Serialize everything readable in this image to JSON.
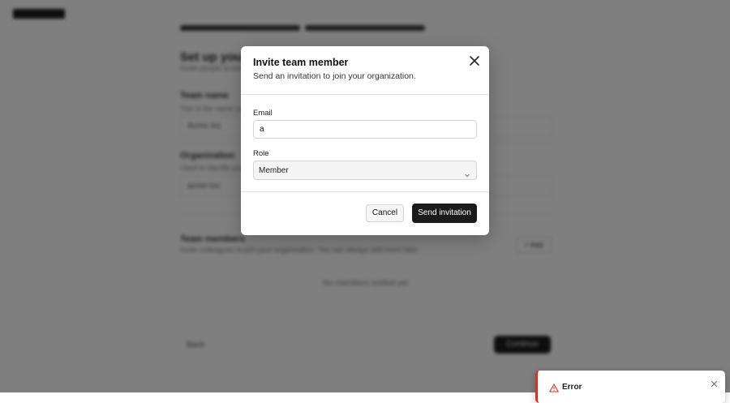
{
  "background": {
    "heading": "Set up your team",
    "subheading": "Invite people to collaborate in your organization",
    "section1_label": "Team name",
    "section1_hint": "This is the name your team will see",
    "section1_value": "Acme Inc",
    "section2_label": "Organization",
    "section2_hint": "Used to identify your workspace",
    "section2_value": "acme-inc",
    "section3_label": "Team members",
    "section3_hint": "Invite colleagues to join your organization. You can always add more later.",
    "add_button": "+ Add",
    "empty_state": "No members invited yet",
    "back_label": "Back",
    "continue_label": "Continue"
  },
  "modal": {
    "title": "Invite team member",
    "description": "Send an invitation to join your organization.",
    "email_label": "Email",
    "email_value": "a",
    "role_label": "Role",
    "role_value": "Member",
    "cancel_label": "Cancel",
    "send_label": "Send invitation"
  },
  "toast": {
    "title": "Error"
  },
  "colors": {
    "primary_button": "#1b1b1b",
    "error": "#d93025"
  },
  "icons": {
    "modal_close": "close-icon",
    "role_chevron": "chevron-down-icon",
    "toast_warning": "warning-icon",
    "toast_close": "close-icon"
  }
}
